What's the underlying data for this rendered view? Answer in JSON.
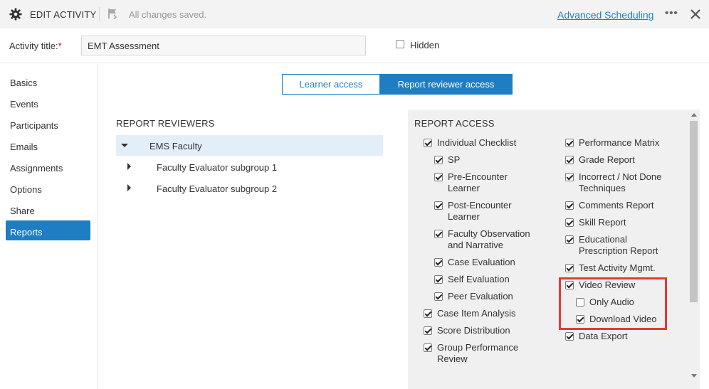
{
  "header": {
    "title": "EDIT ACTIVITY",
    "saved_status": "All changes saved.",
    "advanced_link": "Advanced Scheduling",
    "more_label": "•••",
    "icons": {
      "settings": "gear-icon",
      "save": "save-flag-icon",
      "close": "close-icon"
    }
  },
  "activity": {
    "title_label": "Activity title:",
    "required_mark": "*",
    "title_value": "EMT Assessment",
    "hidden_label": "Hidden",
    "hidden_checked": false
  },
  "sidebar": {
    "items": [
      {
        "label": "Basics",
        "active": false
      },
      {
        "label": "Events",
        "active": false
      },
      {
        "label": "Participants",
        "active": false
      },
      {
        "label": "Emails",
        "active": false
      },
      {
        "label": "Assignments",
        "active": false
      },
      {
        "label": "Options",
        "active": false
      },
      {
        "label": "Share",
        "active": false
      },
      {
        "label": "Reports",
        "active": true
      }
    ]
  },
  "tabs": [
    {
      "label": "Learner access",
      "active": false
    },
    {
      "label": "Report reviewer access",
      "active": true
    }
  ],
  "reviewers": {
    "heading": "REPORT REVIEWERS",
    "groups": [
      {
        "label": "EMS Faculty",
        "expanded": true,
        "selected": true
      },
      {
        "label": "Faculty Evaluator subgroup 1",
        "expanded": false
      },
      {
        "label": "Faculty Evaluator subgroup 2",
        "expanded": false
      }
    ]
  },
  "report_access": {
    "heading": "REPORT ACCESS",
    "left": [
      {
        "label": "Individual Checklist",
        "checked": true
      },
      {
        "label": "SP",
        "checked": true
      },
      {
        "label": "Pre-Encounter Learner",
        "checked": true
      },
      {
        "label": "Post-Encounter Learner",
        "checked": true
      },
      {
        "label": "Faculty Observation and Narrative",
        "checked": true
      },
      {
        "label": "Case Evaluation",
        "checked": true
      },
      {
        "label": "Self Evaluation",
        "checked": true
      },
      {
        "label": "Peer Evaluation",
        "checked": true
      },
      {
        "label": "Case Item Analysis",
        "checked": true
      },
      {
        "label": "Score Distribution",
        "checked": true
      },
      {
        "label": "Group Performance Review",
        "checked": true
      }
    ],
    "right": [
      {
        "label": "Performance Matrix",
        "checked": true
      },
      {
        "label": "Grade Report",
        "checked": true
      },
      {
        "label": "Incorrect / Not Done Techniques",
        "checked": true
      },
      {
        "label": "Comments Report",
        "checked": true
      },
      {
        "label": "Skill Report",
        "checked": true
      },
      {
        "label": "Educational Prescription Report",
        "checked": true
      },
      {
        "label": "Test Activity Mgmt.",
        "checked": true
      },
      {
        "label": "Video Review",
        "checked": true
      },
      {
        "label": "Only Audio",
        "checked": false
      },
      {
        "label": "Download Video",
        "checked": true
      },
      {
        "label": "Data Export",
        "checked": true
      }
    ]
  },
  "colors": {
    "accent": "#1f7dc2",
    "highlight": "#e53935",
    "panel_bg": "#f0f0f0"
  }
}
